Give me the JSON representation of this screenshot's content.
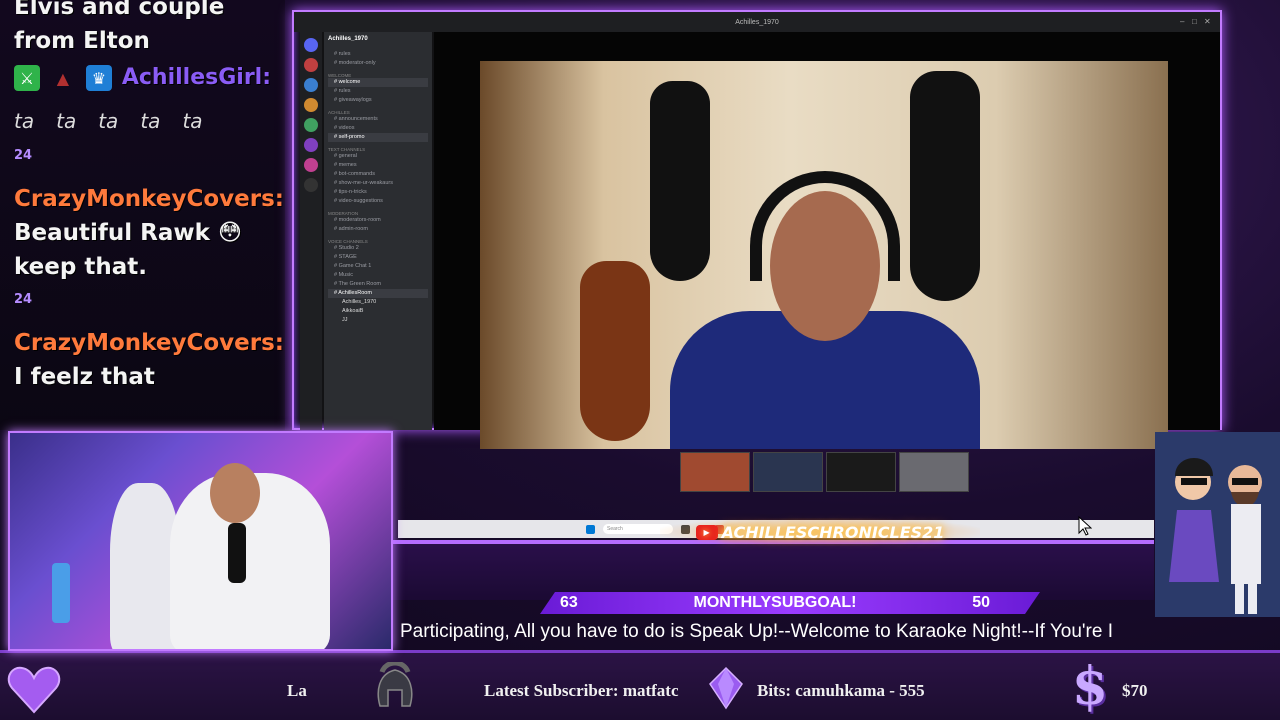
{
  "chat": {
    "line1_text": "Elvis and couple from Elton",
    "user1": "AchillesGirl:",
    "emote_text": "ta",
    "sub_badge_label": "24",
    "user2": "CrazyMonkeyCovers:",
    "msg2": "Beautiful Rawk 😳 keep that.",
    "user3": "CrazyMonkeyCovers:",
    "msg3": "I feelz that"
  },
  "window": {
    "title": "Achilles_1970",
    "server_name": "Achilles_1970",
    "channels": [
      {
        "label": "rules",
        "active": false
      },
      {
        "label": "moderator-only",
        "active": false
      },
      {
        "label": "Welcome",
        "category": true
      },
      {
        "label": "welcome",
        "active": true
      },
      {
        "label": "rules",
        "active": false
      },
      {
        "label": "giveawaylogs",
        "active": false
      },
      {
        "label": "Achilles",
        "category": true
      },
      {
        "label": "announcements",
        "active": false
      },
      {
        "label": "videos",
        "active": false
      },
      {
        "label": "self-promo",
        "active": true
      },
      {
        "label": "Text Channels",
        "category": true
      },
      {
        "label": "general",
        "active": false
      },
      {
        "label": "memes",
        "active": false
      },
      {
        "label": "bot-commands",
        "active": false
      },
      {
        "label": "show-me-ur-weakaurs",
        "active": false
      },
      {
        "label": "tips-n-tricks",
        "active": false
      },
      {
        "label": "video-suggestions",
        "active": false
      },
      {
        "label": "Moderation",
        "category": true
      },
      {
        "label": "moderators-room",
        "active": false
      },
      {
        "label": "admin-room",
        "active": false
      },
      {
        "label": "Voice Channels",
        "category": true
      },
      {
        "label": "Studio 2",
        "active": false
      },
      {
        "label": "STAGE",
        "active": false
      },
      {
        "label": "Game Chat 1",
        "active": false
      },
      {
        "label": "Music",
        "active": false
      },
      {
        "label": "The Green Room",
        "active": false
      },
      {
        "label": "AchillesRoom",
        "active": true
      }
    ],
    "voice_users": [
      "Achilles_1970",
      "AikkoaiB",
      "JJ"
    ],
    "taskbar_search_placeholder": "Search"
  },
  "banner": {
    "channel_name": "ACHILLESCHRONICLES21"
  },
  "subgoal": {
    "current": "63",
    "label": "MONTHLYSUBGOAL!",
    "target": "50"
  },
  "ticker": {
    "text": "Participating, All you have to do is Speak Up!--Welcome to Karaoke Night!--If You're I"
  },
  "bottom_bar": {
    "left_fragment": "La",
    "latest_subscriber": "Latest Subscriber: matfatc",
    "bits": "Bits: camuhkama - 555",
    "donation": "$70",
    "dollar_glyph": "$"
  },
  "colors": {
    "accent_purple": "#c27bff",
    "username_orange": "#ff7a3c",
    "username_purple": "#8a5cf5",
    "subgoal_bar": "#9b3cff"
  },
  "icons": [
    "heart-icon",
    "spartan-helmet-icon",
    "crystal-icon",
    "dollar-icon",
    "youtube-icon",
    "cursor-icon"
  ]
}
